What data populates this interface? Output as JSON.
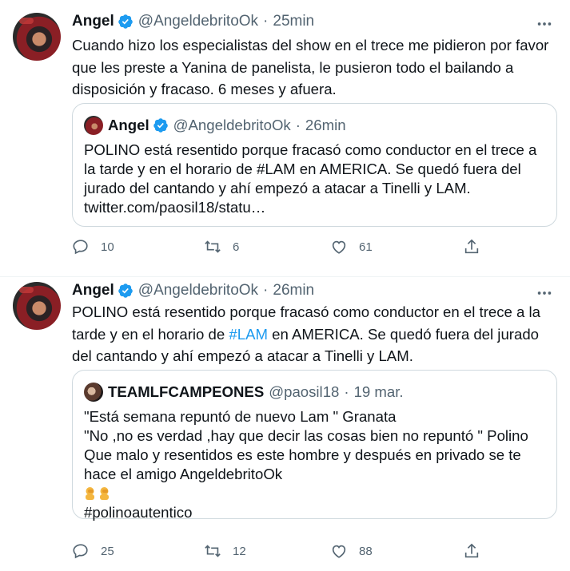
{
  "colors": {
    "text": "#0f1419",
    "secondary": "#536471",
    "link": "#1d9bf0",
    "border": "#cfd9de"
  },
  "tweets": [
    {
      "name": "Angel",
      "handle": "@AngeldebritoOk",
      "time": "25min",
      "sep": "·",
      "verified": true,
      "text": "Cuando hizo los especialistas del show en el trece me pidieron por favor que les preste a Yanina de panelista, le pusieron todo el bailando a disposición y fracaso. 6 meses y afuera.",
      "quote": {
        "name": "Angel",
        "handle": "@AngeldebritoOk",
        "time": "26min",
        "sep": "·",
        "text": "POLINO está resentido porque fracasó como conductor en el trece a la tarde y en el horario de #LAM en AMERICA. Se quedó fuera del jurado del cantando y ahí empezó a atacar a Tinelli y LAM.\ntwitter.com/paosil18/statu…"
      },
      "actions": {
        "replies": "10",
        "retweets": "6",
        "likes": "61"
      }
    },
    {
      "name": "Angel",
      "handle": "@AngeldebritoOk",
      "time": "26min",
      "sep": "·",
      "verified": true,
      "text_before": "POLINO está resentido porque fracasó como conductor en el trece a la tarde y en el horario de ",
      "hashtag": "#LAM",
      "text_after": " en AMERICA. Se quedó fuera del jurado del cantando y ahí empezó a atacar a Tinelli y LAM.",
      "quote": {
        "name": "TEAMLFCAMPEONES",
        "handle": "@paosil18",
        "time": "19 mar.",
        "sep": "·",
        "text": "\"Está semana repuntó de nuevo Lam \" Granata\n\"No ,no es verdad ,hay que decir las cosas bien no repuntó \" Polino\nQue malo y resentidos es este hombre y después en privado se te hace el amigo  AngeldebritoOk",
        "hashtag_line": "#polinoautentico",
        "emoji": "person-facepalming-emoji"
      },
      "actions": {
        "replies": "25",
        "retweets": "12",
        "likes": "88"
      }
    }
  ]
}
